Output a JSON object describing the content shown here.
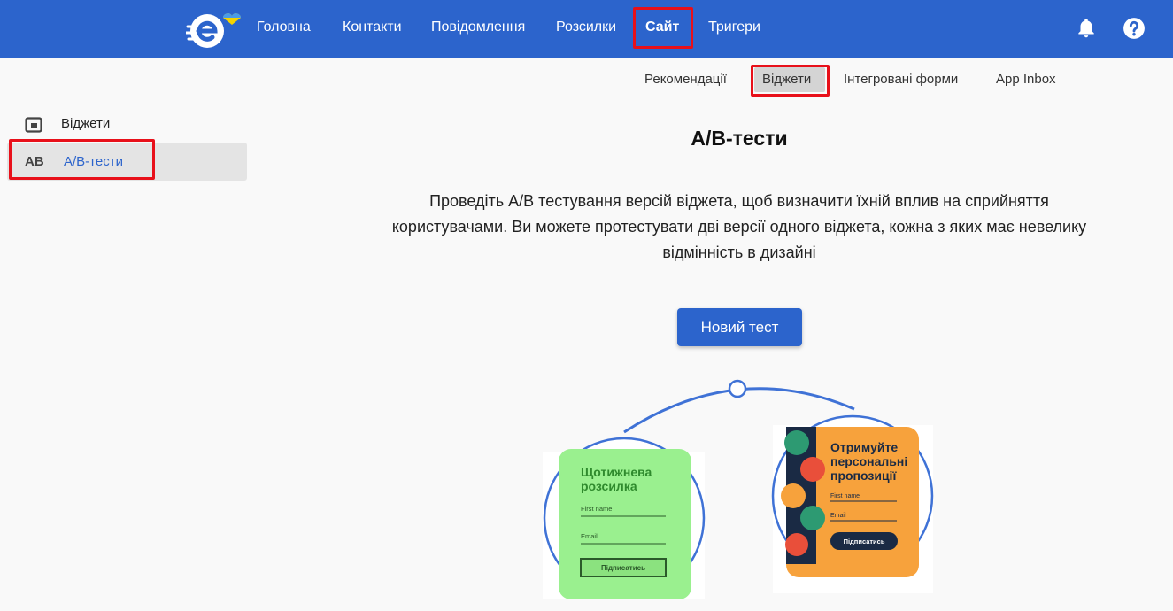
{
  "nav": {
    "items": [
      {
        "label": "Головна"
      },
      {
        "label": "Контакти"
      },
      {
        "label": "Повідомлення"
      },
      {
        "label": "Розсилки"
      },
      {
        "label": "Сайт"
      },
      {
        "label": "Тригери"
      }
    ],
    "active": "Сайт"
  },
  "subnav": {
    "items": [
      {
        "label": "Рекомендації"
      },
      {
        "label": "Віджети"
      },
      {
        "label": "Інтегровані форми"
      },
      {
        "label": "App Inbox"
      }
    ],
    "active": "Віджети"
  },
  "sidebar": {
    "items": [
      {
        "label": "Віджети",
        "icon": "widget-icon"
      },
      {
        "label": "A/B-тести",
        "icon_text": "AB"
      }
    ],
    "active": "A/B-тести"
  },
  "main": {
    "title": "A/B-тести",
    "description": "Проведіть A/B тестування версій віджета, щоб визначити їхній вплив на сприйняття користувачами. Ви можете протестувати дві версії одного віджета, кожна з яких має невелику відмінність в дизайні",
    "button_label": "Новий тест"
  },
  "illustration": {
    "card_green": {
      "title_line1": "Щотижнева",
      "title_line2": "розсилка",
      "field1": "First name",
      "field2": "Email",
      "button": "Підписатись",
      "color": "#9af08f"
    },
    "card_orange": {
      "title_line1": "Отримуйте",
      "title_line2": "персональні",
      "title_line3": "пропозиції",
      "field1": "First name",
      "field2": "Email",
      "button": "Підписатись",
      "color": "#f7a23c"
    }
  },
  "colors": {
    "brand": "#2c64cc",
    "highlight": "#e8101a"
  }
}
